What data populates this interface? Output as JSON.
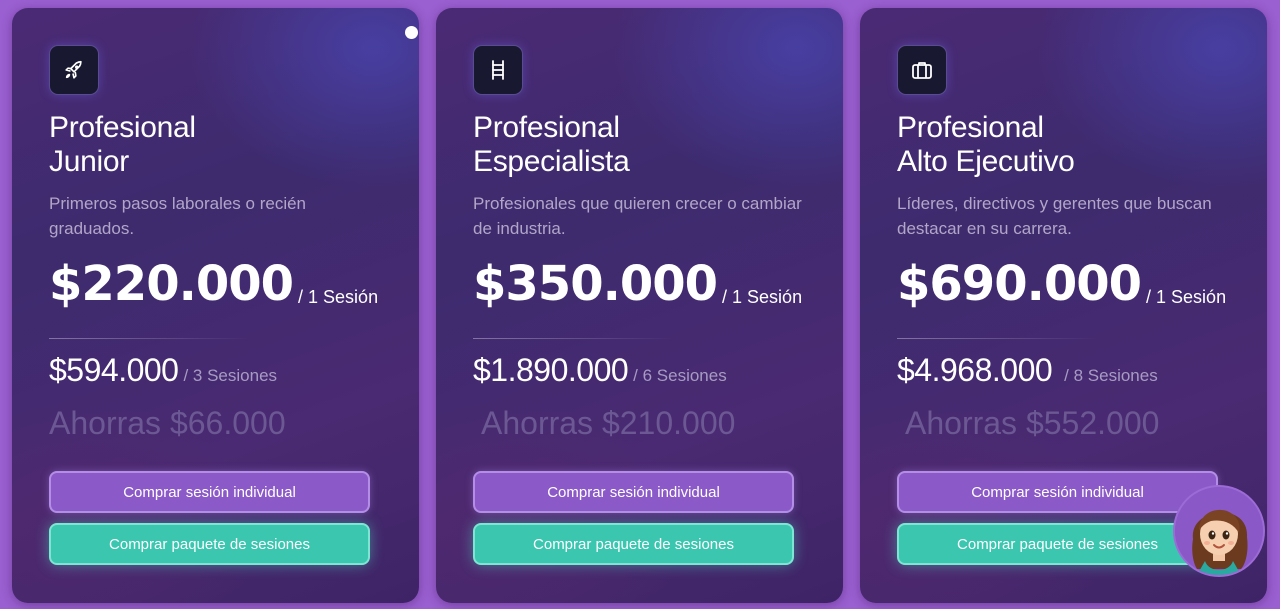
{
  "plans": [
    {
      "icon": "rocket-icon",
      "title_line1": "Profesional",
      "title_line2": "Junior",
      "description": "Primeros pasos laborales o recién graduados.",
      "price": "$220.000",
      "price_unit": "/ 1 Sesión",
      "package_price": "$594.000",
      "package_unit": "/ 3 Sesiones",
      "savings": "Ahorras $66.000",
      "btn_individual": "Comprar sesión individual",
      "btn_package": "Comprar paquete de sesiones"
    },
    {
      "icon": "ladder-icon",
      "title_line1": "Profesional",
      "title_line2": "Especialista",
      "description": "Profesionales que quieren crecer o cambiar de industria.",
      "price": "$350.000",
      "price_unit": "/ 1 Sesión",
      "package_price": "$1.890.000",
      "package_unit": "/ 6 Sesiones",
      "savings": "Ahorras $210.000",
      "btn_individual": "Comprar sesión individual",
      "btn_package": "Comprar paquete de sesiones"
    },
    {
      "icon": "briefcase-icon",
      "title_line1": "Profesional",
      "title_line2": "Alto Ejecutivo",
      "description": "Líderes, directivos y gerentes que buscan destacar en su carrera.",
      "price": "$690.000",
      "price_unit": "/ 1 Sesión",
      "package_price": "$4.968.000",
      "package_unit": "/ 8 Sesiones",
      "savings": "Ahorras $552.000",
      "btn_individual": "Comprar sesión individual",
      "btn_package": "Comprar paquete de sesiones"
    }
  ],
  "colors": {
    "page_background": "#9a5fd0",
    "card_background": "#412a70",
    "button_individual": "#8b5ac8",
    "button_package": "#3bc6b0",
    "savings_text": "#6c5893"
  },
  "assistant": {
    "icon": "assistant-avatar-icon"
  }
}
